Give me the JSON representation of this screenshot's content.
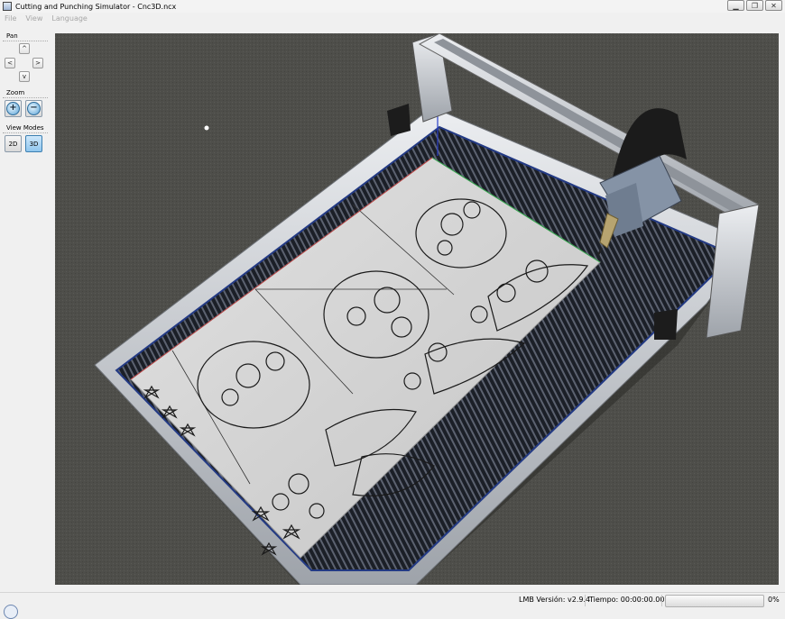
{
  "window": {
    "title": "Cutting and Punching Simulator - Cnc3D.ncx",
    "controls": {
      "minimize": "▁",
      "restore": "❐",
      "close": "✕"
    }
  },
  "menu": [
    "File",
    "View",
    "Language"
  ],
  "panel": {
    "pan_label": "Pan",
    "pan": {
      "up": "^",
      "left": "<",
      "right": ">",
      "down": "v"
    },
    "zoom_label": "Zoom",
    "zoom_in": "+",
    "zoom_out": "−",
    "view_modes_label": "View Modes",
    "mode_2d": "2D",
    "mode_3d": "3D",
    "active_mode": "3D"
  },
  "status": {
    "version": "LMB Versión: v2.9.4",
    "time": "Tiempo: 00:00:00.000",
    "progress_text": "0%",
    "progress_value": 0
  },
  "colors": {
    "floor": "#4e4e4a",
    "frame": "#c6c8cc",
    "sheet": "#d2d2d2",
    "accent_active": "#8fc6ee",
    "progress_fill": "#4db82d"
  },
  "icons": {
    "app": "app-icon",
    "zoom_in": "zoom-in-icon",
    "zoom_out": "zoom-out-icon",
    "status_corner": "status-icon"
  }
}
